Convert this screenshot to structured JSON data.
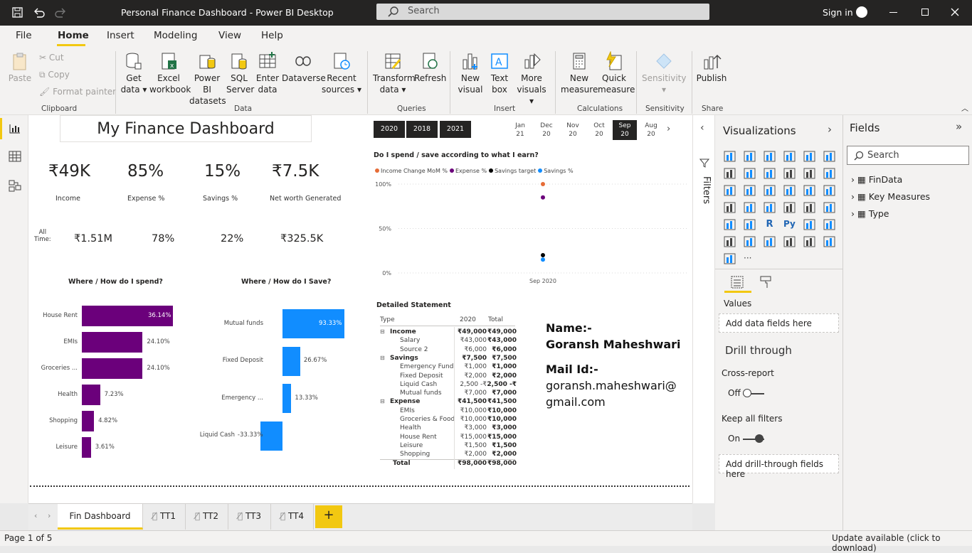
{
  "app": {
    "title": "Personal Finance Dashboard - Power BI Desktop",
    "search_placeholder": "Search",
    "sign_in": "Sign in"
  },
  "menu": [
    "File",
    "Home",
    "Insert",
    "Modeling",
    "View",
    "Help"
  ],
  "ribbon": {
    "clipboard": {
      "paste": "Paste",
      "cut": "Cut",
      "copy": "Copy",
      "format_painter": "Format painter",
      "group": "Clipboard"
    },
    "data": {
      "get_data_1": "Get",
      "get_data_2": "data",
      "excel_1": "Excel",
      "excel_2": "workbook",
      "pbi_1": "Power BI",
      "pbi_2": "datasets",
      "sql_1": "SQL",
      "sql_2": "Server",
      "enter_1": "Enter",
      "enter_2": "data",
      "dataverse": "Dataverse",
      "recent_1": "Recent",
      "recent_2": "sources",
      "group": "Data"
    },
    "queries": {
      "transform_1": "Transform",
      "transform_2": "data",
      "refresh": "Refresh",
      "group": "Queries"
    },
    "insert": {
      "new_visual_1": "New",
      "new_visual_2": "visual",
      "text_box_1": "Text",
      "text_box_2": "box",
      "more_visuals_1": "More",
      "more_visuals_2": "visuals",
      "group": "Insert"
    },
    "calculations": {
      "new_measure_1": "New",
      "new_measure_2": "measure",
      "quick_measure_1": "Quick",
      "quick_measure_2": "measure",
      "group": "Calculations"
    },
    "sensitivity": {
      "label": "Sensitivity",
      "group": "Sensitivity"
    },
    "share": {
      "publish": "Publish",
      "group": "Share"
    }
  },
  "dashboard": {
    "title": "My Finance Dashboard",
    "kpis": [
      {
        "value": "₹49K",
        "label": "Income"
      },
      {
        "value": "85%",
        "label": "Expense %"
      },
      {
        "value": "15%",
        "label": "Savings %"
      },
      {
        "value": "₹7.5K",
        "label": "Net worth Generated"
      }
    ],
    "all_time": {
      "label_1": "All",
      "label_2": "Time:",
      "values": [
        "₹1.51M",
        "78%",
        "22%",
        "₹325.5K"
      ]
    },
    "years": [
      "2020",
      "2018",
      "2021"
    ],
    "months": [
      {
        "m": "Jan",
        "y": "21"
      },
      {
        "m": "Dec",
        "y": "20"
      },
      {
        "m": "Nov",
        "y": "20"
      },
      {
        "m": "Oct",
        "y": "20"
      },
      {
        "m": "Sep",
        "y": "20"
      },
      {
        "m": "Aug",
        "y": "20"
      }
    ],
    "scatter": {
      "title": "Do I spend / save according to what I earn?",
      "legend": [
        {
          "name": "Income Change MoM %",
          "color": "#e66c37"
        },
        {
          "name": "Expense %",
          "color": "#6b007b"
        },
        {
          "name": "Savings target",
          "color": "#000000"
        },
        {
          "name": "Savings %",
          "color": "#118dff"
        }
      ],
      "yticks": [
        "100%",
        "50%",
        "0%"
      ],
      "xlabel": "Sep 2020"
    },
    "statement": {
      "title": "Detailed Statement",
      "headers": [
        "Type",
        "2020",
        "Total"
      ],
      "rows": [
        {
          "name": "Income",
          "v": "₹49,000",
          "t": "₹49,000",
          "bold": true,
          "exp": true
        },
        {
          "name": "Salary",
          "v": "₹43,000",
          "t": "₹43,000"
        },
        {
          "name": "Source 2",
          "v": "₹6,000",
          "t": "₹6,000"
        },
        {
          "name": "Savings",
          "v": "₹7,500",
          "t": "₹7,500",
          "bold": true,
          "exp": true
        },
        {
          "name": "Emergency Fund",
          "v": "₹1,000",
          "t": "₹1,000"
        },
        {
          "name": "Fixed Deposit",
          "v": "₹2,000",
          "t": "₹2,000"
        },
        {
          "name": "Liquid Cash",
          "v": "2,500 -₹",
          "t": "2,500 -₹"
        },
        {
          "name": "Mutual funds",
          "v": "₹7,000",
          "t": "₹7,000"
        },
        {
          "name": "Expense",
          "v": "₹41,500",
          "t": "₹41,500",
          "bold": true,
          "exp": true
        },
        {
          "name": "EMIs",
          "v": "₹10,000",
          "t": "₹10,000"
        },
        {
          "name": "Groceries & Food",
          "v": "₹10,000",
          "t": "₹10,000"
        },
        {
          "name": "Health",
          "v": "₹3,000",
          "t": "₹3,000"
        },
        {
          "name": "House Rent",
          "v": "₹15,000",
          "t": "₹15,000"
        },
        {
          "name": "Leisure",
          "v": "₹1,500",
          "t": "₹1,500"
        },
        {
          "name": "Shopping",
          "v": "₹2,000",
          "t": "₹2,000"
        },
        {
          "name": "Total",
          "v": "₹98,000",
          "t": "₹98,000",
          "bold": true,
          "total": true
        }
      ]
    },
    "name_card": {
      "name_label": "Name:-",
      "name": "Goransh Maheshwari",
      "mail_label": "Mail Id:-",
      "mail_1": "goransh.maheshwari@",
      "mail_2": "gmail.com"
    }
  },
  "chart_data": [
    {
      "type": "bar",
      "title": "Where / How do I spend?",
      "categories": [
        "House Rent",
        "EMIs",
        "Groceries ...",
        "Health",
        "Shopping",
        "Leisure"
      ],
      "values": [
        36.14,
        24.1,
        24.1,
        7.23,
        4.82,
        3.61
      ],
      "labels": [
        "36.14%",
        "24.10%",
        "24.10%",
        "7.23%",
        "4.82%",
        "3.61%"
      ],
      "color": "#6b007b"
    },
    {
      "type": "bar",
      "title": "Where / How do I Save?",
      "categories": [
        "Mutual funds",
        "Fixed Deposit",
        "Emergency ...",
        "Liquid Cash"
      ],
      "values": [
        93.33,
        26.67,
        13.33,
        -33.33
      ],
      "labels": [
        "93.33%",
        "26.67%",
        "13.33%",
        "-33.33%"
      ],
      "color": "#118dff"
    },
    {
      "type": "scatter",
      "title": "Do I spend / save according to what I earn?",
      "x": [
        "Sep 2020"
      ],
      "ylim": [
        0,
        100
      ],
      "series": [
        {
          "name": "Income Change MoM %",
          "values": [
            100
          ]
        },
        {
          "name": "Expense %",
          "values": [
            85
          ]
        },
        {
          "name": "Savings target",
          "values": [
            20
          ]
        },
        {
          "name": "Savings %",
          "values": [
            15
          ]
        }
      ]
    }
  ],
  "panes": {
    "filters": "Filters",
    "visualizations": "Visualizations",
    "fields": "Fields",
    "fields_search": "Search",
    "values": "Values",
    "add_data_fields": "Add data fields here",
    "drill_through": "Drill through",
    "cross_report": "Cross-report",
    "cross_report_state": "Off",
    "keep_filters": "Keep all filters",
    "keep_filters_state": "On",
    "add_drill": "Add drill-through fields here",
    "tables": [
      "FinData",
      "Key Measures",
      "Type"
    ]
  },
  "tabs": {
    "active": "Fin Dashboard",
    "others": [
      "TT1",
      "TT2",
      "TT3",
      "TT4"
    ]
  },
  "status": {
    "page": "Page 1 of 5",
    "update": "Update available (click to download)"
  }
}
